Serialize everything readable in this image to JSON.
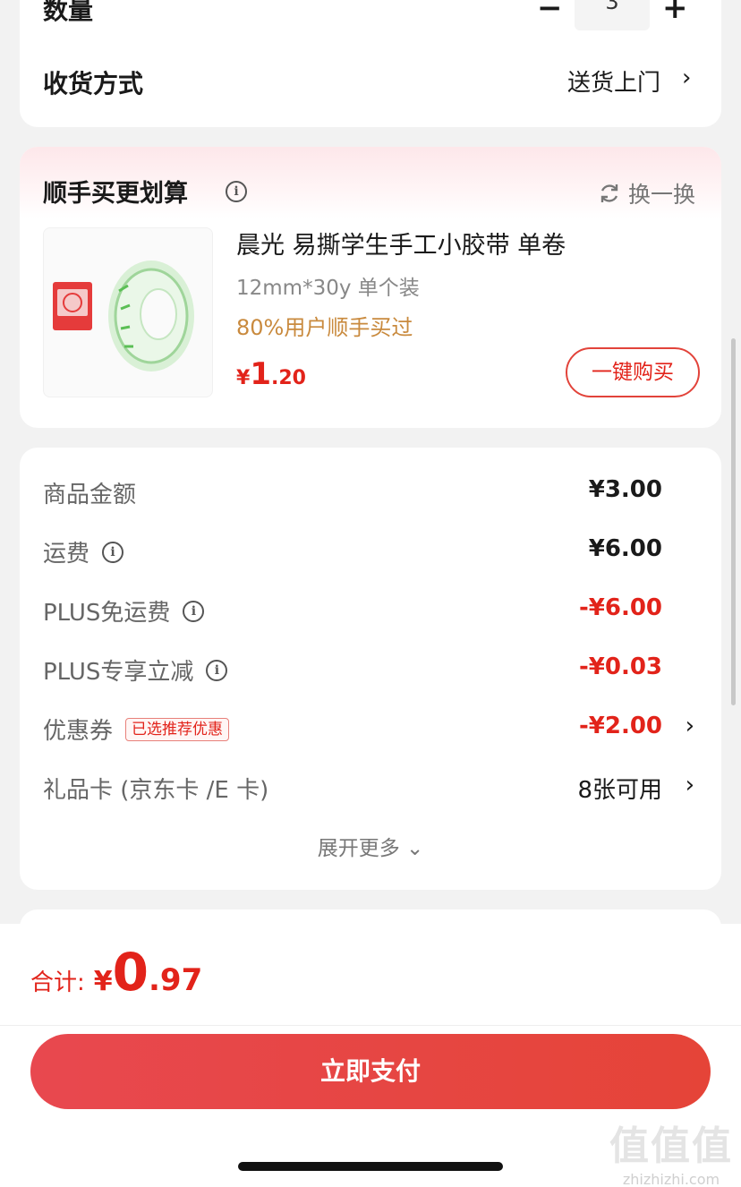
{
  "order": {
    "quantity_label": "数量",
    "quantity_value": "3",
    "delivery_label": "收货方式",
    "delivery_value": "送货上门"
  },
  "recommendation": {
    "title": "顺手买更划算",
    "swap_label": "换一换",
    "product": {
      "name": "晨光 易撕学生手工小胶带 单卷",
      "spec": "12mm*30y 单个装",
      "social_proof": "80%用户顺手买过",
      "price_currency": "¥",
      "price_int": "1",
      "price_dec": ".20",
      "buy_label": "一键购买"
    }
  },
  "price_breakdown": {
    "rows": [
      {
        "label": "商品金额",
        "value": "¥3.00"
      },
      {
        "label": "运费",
        "value": "¥6.00"
      },
      {
        "label": "PLUS免运费",
        "value": "-¥6.00"
      },
      {
        "label": "PLUS专享立减",
        "value": "-¥0.03"
      },
      {
        "label": "优惠券",
        "tag": "已选推荐优惠",
        "value": "-¥2.00"
      },
      {
        "label": "礼品卡 (京东卡 /E 卡)",
        "value": "8张可用"
      }
    ],
    "expand_label": "展开更多"
  },
  "footer": {
    "total_label": "合计:",
    "total_currency": "¥",
    "total_int": "0",
    "total_dec": ".97",
    "pay_label": "立即支付"
  },
  "watermark": {
    "logo": "值值值",
    "url": "zhizhizhi.com"
  },
  "colors": {
    "accent_red": "#e2231a",
    "social_gold": "#c98a3e",
    "pay_button": "#e54438"
  },
  "icons": [
    "minus-icon",
    "plus-icon",
    "chevron-right-icon",
    "info-icon",
    "refresh-icon",
    "chevron-down-icon"
  ]
}
